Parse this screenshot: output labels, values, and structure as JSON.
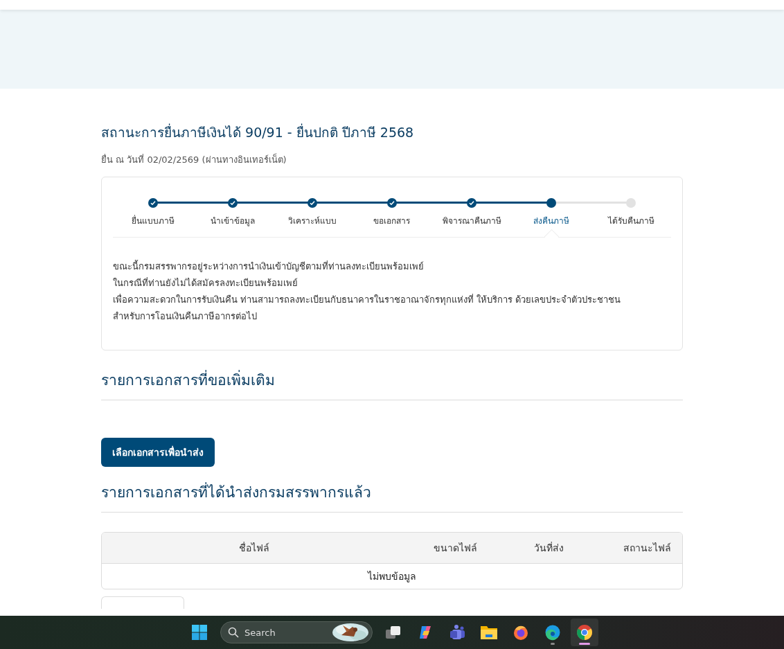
{
  "page": {
    "title": "สถานะการยื่นภาษีเงินได้ 90/91 - ยื่นปกติ ปีภาษี 2568",
    "subtitle": "ยื่น ณ วันที่ 02/02/2569 (ผ่านทางอินเทอร์เน็ต)"
  },
  "steps": [
    {
      "label": "ยื่นแบบภาษี",
      "done": true,
      "selected": false
    },
    {
      "label": "นำเข้าข้อมูล",
      "done": true,
      "selected": false
    },
    {
      "label": "วิเคราะห์แบบ",
      "done": true,
      "selected": false
    },
    {
      "label": "ขอเอกสาร",
      "done": true,
      "selected": false
    },
    {
      "label": "พิจารณาคืนภาษี",
      "done": true,
      "selected": false
    },
    {
      "label": "ส่งคืนภาษี",
      "done": false,
      "selected": true
    },
    {
      "label": "ได้รับคืนภาษี",
      "done": false,
      "selected": false
    }
  ],
  "message": [
    "ขณะนี้กรมสรรพากรอยู่ระหว่างการนำเงินเข้าบัญชีตามที่ท่านลงทะเบียนพร้อมเพย์",
    "ในกรณีที่ท่านยังไม่ได้สมัครลงทะเบียนพร้อมเพย์",
    "เพื่อความสะดวกในการรับเงินคืน ท่านสามารถลงทะเบียนกับธนาคารในราชอาณาจักรทุกแห่งที่ ให้บริการ ด้วยเลขประจำตัวประชาชน",
    "สำหรับการโอนเงินคืนภาษีอากรต่อไป"
  ],
  "requested_section": {
    "heading": "รายการเอกสารที่ขอเพิ่มเติม",
    "button": "เลือกเอกสารเพื่อนำส่ง"
  },
  "submitted_section": {
    "heading": "รายการเอกสารที่ได้นำส่งกรมสรรพากรแล้ว",
    "table": {
      "columns": [
        "ชื่อไฟล์",
        "ขนาดไฟล์",
        "วันที่ส่ง",
        "สถานะไฟล์"
      ],
      "empty_message": "ไม่พบข้อมูล"
    }
  },
  "close_button": {
    "kind": "button"
  },
  "taskbar": {
    "search": "Search",
    "apps": [
      {
        "kind": "start",
        "selected": false,
        "running": false
      },
      {
        "kind": "taskview",
        "selected": false,
        "running": false
      },
      {
        "kind": "copilot",
        "selected": false,
        "running": false
      },
      {
        "kind": "teams",
        "selected": false,
        "running": false
      },
      {
        "kind": "files",
        "selected": false,
        "running": false
      },
      {
        "kind": "firefox",
        "selected": false,
        "running": false
      },
      {
        "kind": "edge",
        "selected": false,
        "running": true
      },
      {
        "kind": "chrome",
        "selected": true,
        "running": true
      }
    ]
  }
}
